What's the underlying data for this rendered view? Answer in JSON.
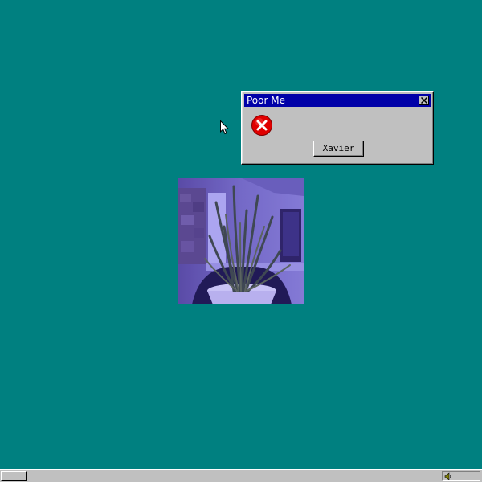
{
  "desktop": {
    "background_color": "#008080"
  },
  "dialog": {
    "title": "Poor Me",
    "titlebar_color": "#0000a8",
    "icon": "error-icon",
    "close_icon": "close-icon",
    "button_label": "Xavier"
  },
  "photo": {
    "subject": "potted-plant-webcam-photo"
  },
  "taskbar": {
    "start_icon": "start-button",
    "tray_icon": "speaker-icon"
  },
  "colors": {
    "window_face": "#c0c0c0",
    "error_red": "#e00000"
  }
}
